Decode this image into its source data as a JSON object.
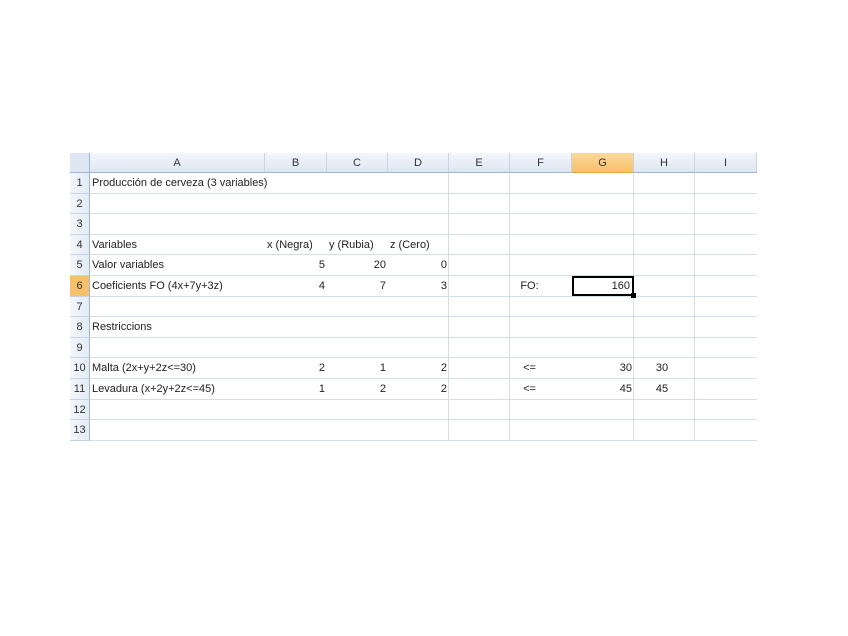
{
  "columns": [
    "A",
    "B",
    "C",
    "D",
    "E",
    "F",
    "G",
    "H",
    "I"
  ],
  "rows": [
    "1",
    "2",
    "3",
    "4",
    "5",
    "6",
    "7",
    "8",
    "9",
    "10",
    "11",
    "12",
    "13"
  ],
  "cells": {
    "A1": "Producción de cerveza (3 variables)",
    "A4": "Variables",
    "B4": "x (Negra)",
    "C4": "y (Rubia)",
    "D4": "z (Cero)",
    "A5": "Valor variables",
    "B5": "5",
    "C5": "20",
    "D5": "0",
    "A6": "Coeficients FO (4x+7y+3z)",
    "B6": "4",
    "C6": "7",
    "D6": "3",
    "F6": "FO:",
    "G6": "160",
    "A8": "Restriccions",
    "A10": "Malta (2x+y+2z<=30)",
    "B10": "2",
    "C10": "1",
    "D10": "2",
    "F10": "<=",
    "G10": "30",
    "H10": "30",
    "A11": "Levadura (x+2y+2z<=45)",
    "B11": "1",
    "C11": "2",
    "D11": "2",
    "F11": "<=",
    "G11": "45",
    "H11": "45"
  },
  "selected_cell": "G6"
}
